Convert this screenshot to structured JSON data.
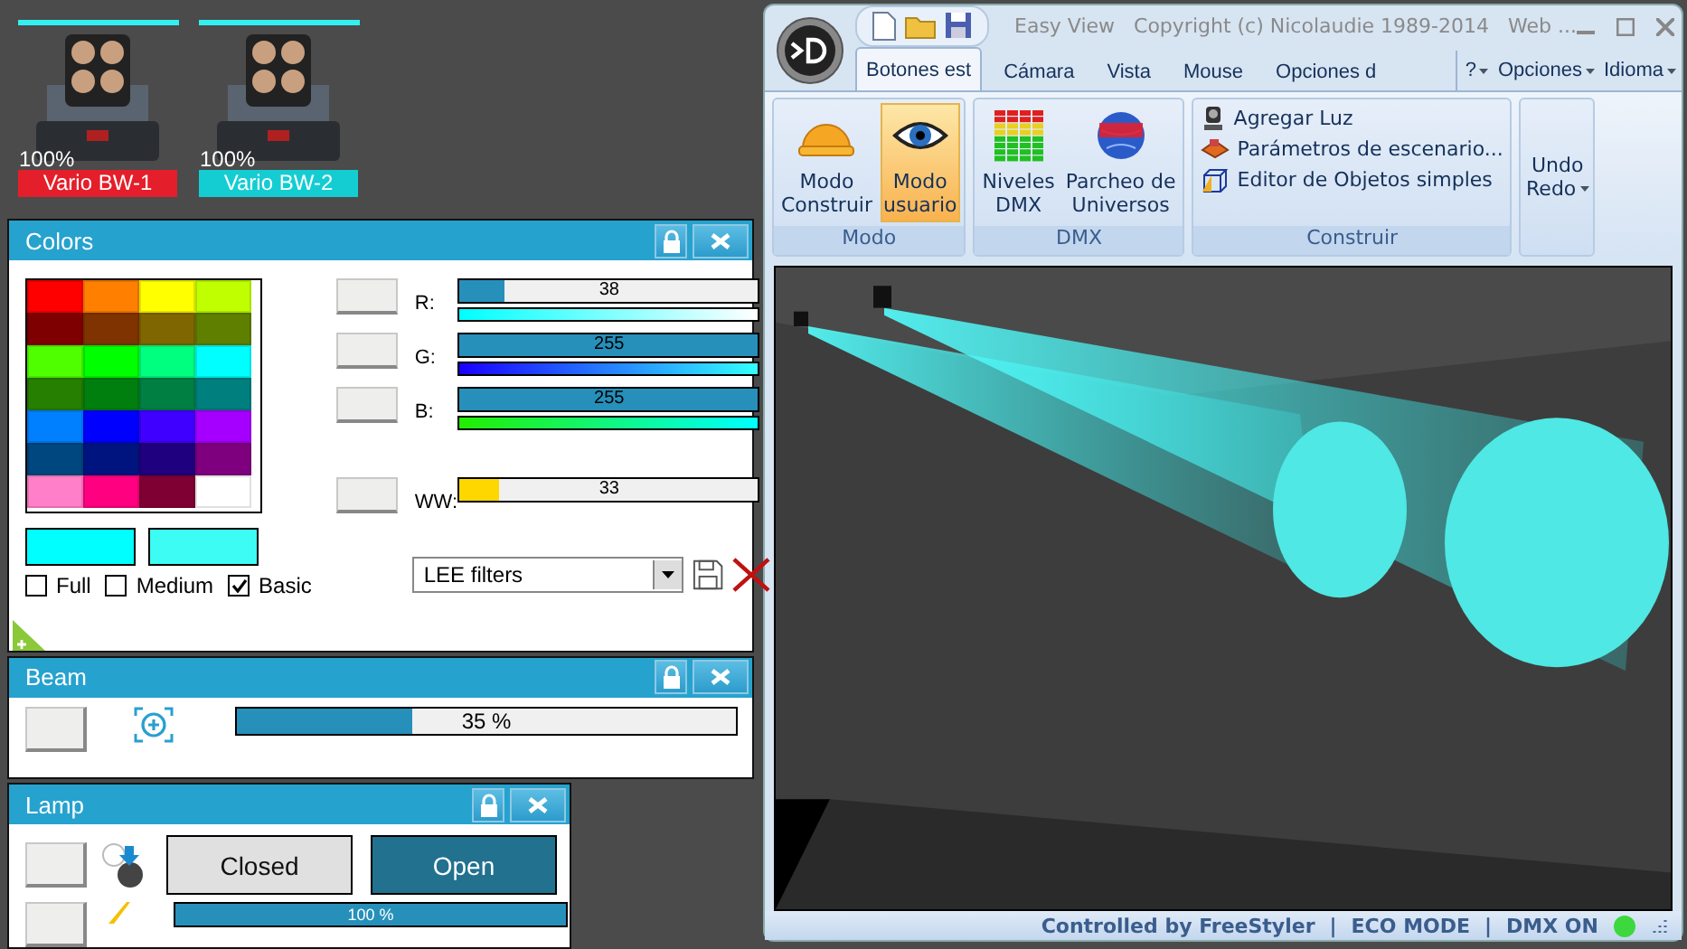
{
  "fixtures": [
    {
      "name": "Vario BW-1",
      "reading": "100%",
      "color": "#e41e2a"
    },
    {
      "name": "Vario BW-2",
      "reading": "100%",
      "color": "#14cdd2"
    }
  ],
  "colors_panel": {
    "title": "Colors",
    "swatches": [
      {
        "color": "#ff0000"
      },
      {
        "color": "#ff7f00"
      },
      {
        "color": "#ffff00"
      },
      {
        "color": "#bfff00"
      },
      {
        "color": "#7f0000"
      },
      {
        "color": "#7f3300"
      },
      {
        "color": "#7f6600"
      },
      {
        "color": "#5f7f00"
      },
      {
        "color": "#4fff00"
      },
      {
        "color": "#00ff00"
      },
      {
        "color": "#00ff7f"
      },
      {
        "color": "#00ffff"
      },
      {
        "color": "#267f00"
      },
      {
        "color": "#007f0f"
      },
      {
        "color": "#007f43"
      },
      {
        "color": "#007f7f"
      },
      {
        "color": "#0080ff"
      },
      {
        "color": "#0000ff"
      },
      {
        "color": "#3f00ff"
      },
      {
        "color": "#a500ff"
      },
      {
        "color": "#00477f"
      },
      {
        "color": "#00147f"
      },
      {
        "color": "#1f007f"
      },
      {
        "color": "#7f007f"
      },
      {
        "color": "#ff80c8"
      },
      {
        "color": "#ff0080"
      },
      {
        "color": "#7f0033"
      },
      {
        "color": "#ffffff"
      }
    ],
    "channels": [
      {
        "label": "R:",
        "value": "38",
        "level": 0.15,
        "color": "#2690bb",
        "kind": "mix"
      },
      {
        "label": "G:",
        "value": "255",
        "level": 1,
        "color": "#2690bb",
        "kind": "mix"
      },
      {
        "label": "B:",
        "value": "255",
        "level": 1,
        "color": "#2690bb",
        "kind": "mix"
      },
      {
        "label": "WW:",
        "value": "33",
        "level": 0.13,
        "color": "#ffd700",
        "kind": "plain"
      }
    ],
    "previews": [
      {
        "color": "#00ffff"
      },
      {
        "color": "#3cfcf4"
      }
    ],
    "checkboxes": [
      {
        "label": "Full",
        "checked": false
      },
      {
        "label": "Medium",
        "checked": false
      },
      {
        "label": "Basic",
        "checked": true
      }
    ],
    "filter": {
      "value": "LEE filters"
    }
  },
  "beam_panel": {
    "title": "Beam",
    "level": 0.35,
    "reading": "35 %"
  },
  "lamp_panel": {
    "title": "Lamp",
    "shutter": [
      {
        "label": "Closed",
        "selected": false
      },
      {
        "label": "Open",
        "selected": true
      }
    ],
    "level": 1,
    "reading": "100 %"
  },
  "window": {
    "title": "Easy View   Copyright (c) Nicolaudie 1989-2014   Web ...",
    "tabs": [
      {
        "label": "Botones est",
        "selected": true
      },
      {
        "label": "Cámara",
        "selected": false
      },
      {
        "label": "Vista",
        "selected": false
      },
      {
        "label": "Mouse",
        "selected": false
      },
      {
        "label": "Opciones d",
        "selected": false
      }
    ],
    "menus": [
      "?",
      "Opciones",
      "Idioma"
    ],
    "groups": [
      {
        "label": "Modo",
        "kind": "large",
        "items": [
          {
            "label": "Modo\nConstruir",
            "kind": "helmet",
            "selected": false
          },
          {
            "label": "Modo\nusuario",
            "kind": "eye",
            "selected": true
          }
        ]
      },
      {
        "label": "DMX",
        "kind": "large",
        "items": [
          {
            "label": "Niveles\nDMX",
            "kind": "levels",
            "selected": false
          },
          {
            "label": "Parcheo de\nUniversos",
            "kind": "globe",
            "selected": false
          }
        ]
      },
      {
        "label": "Construir",
        "kind": "small",
        "items": [
          {
            "label": "Agregar Luz",
            "kind": "spot",
            "selected": false
          },
          {
            "label": "Parámetros de escenario...",
            "kind": "stage",
            "selected": false
          },
          {
            "label": "Editor de Objetos simples",
            "kind": "cube",
            "selected": false
          }
        ]
      },
      {
        "kind": "undo",
        "items": [
          {
            "label": "Undo"
          },
          {
            "label": "Redo"
          }
        ]
      }
    ],
    "status": [
      "Controlled by FreeStyler",
      "|",
      "ECO MODE",
      "|",
      "DMX ON"
    ]
  }
}
